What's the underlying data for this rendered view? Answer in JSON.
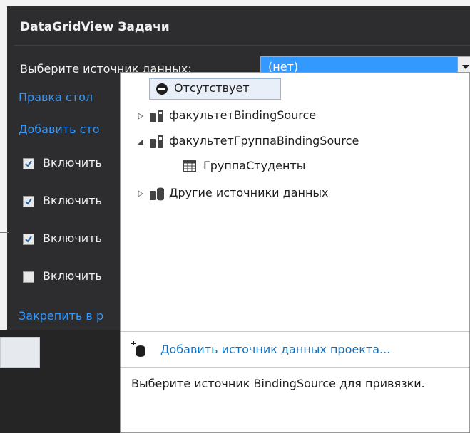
{
  "panel": {
    "title": "DataGridView Задачи",
    "datasource_label": "Выберите источник данных:",
    "datasource_value": "(нет)",
    "links": [
      "Правка стол",
      "Добавить сто"
    ],
    "checkboxes": [
      {
        "label": "Включить",
        "checked": true
      },
      {
        "label": "Включить",
        "checked": true
      },
      {
        "label": "Включить",
        "checked": true
      },
      {
        "label": "Включить",
        "checked": false
      }
    ],
    "dock_link": "Закрепить в р"
  },
  "dropdown": {
    "tree": [
      {
        "label": "Отсутствует",
        "icon": "none-icon",
        "selected": true
      },
      {
        "label": "факультетBindingSource",
        "icon": "bindingsource-icon",
        "expander": "collapsed"
      },
      {
        "label": "факультетГруппаBindingSource",
        "icon": "bindingsource-icon",
        "expander": "expanded"
      },
      {
        "label": "ГруппаСтуденты",
        "icon": "table-icon"
      },
      {
        "label": "Другие источники данных",
        "icon": "database-icon",
        "expander": "collapsed"
      }
    ],
    "add_source": "Добавить источник данных проекта...",
    "help_text": "Выберите источник BindingSource для привязки."
  },
  "colors": {
    "panel_bg": "#2d2d30",
    "accent": "#3399ff",
    "link": "#0e70c0"
  }
}
